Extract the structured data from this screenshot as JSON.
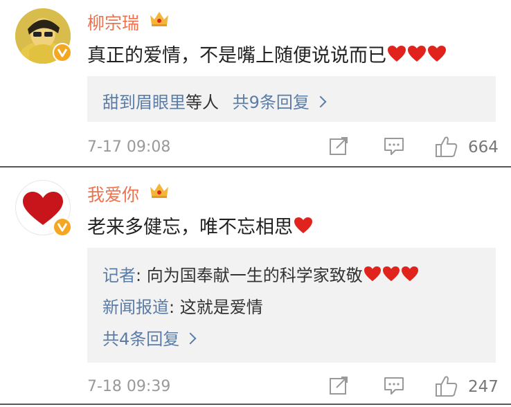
{
  "comments": [
    {
      "username": "柳宗瑞",
      "text": "真正的爱情，不是嘴上随便说说而已",
      "reply_summary": {
        "names": "甜到眉眼里",
        "suffix": "等人",
        "count_label": "共9条回复"
      },
      "time": "7-17 09:08",
      "likes": "664"
    },
    {
      "username": "我爱你",
      "text": "老来多健忘，唯不忘相思",
      "replies": [
        {
          "author": "记者",
          "text": ": 向为国奉献一生的科学家致敬"
        },
        {
          "author": "新闻报道",
          "text": ": 这就是爱情"
        }
      ],
      "more_label": "共4条回复",
      "time": "7-18 09:39",
      "likes": "247"
    }
  ],
  "colors": {
    "username": "#eb7350",
    "link": "#5a7ca6",
    "heart": "#e0241d",
    "verified_badge": "#f5a623",
    "reply_bg": "#f2f2f2"
  },
  "icons": [
    "crown-icon",
    "verified-icon",
    "heart-icon",
    "share-icon",
    "comment-icon",
    "like-icon",
    "chevron-right-icon"
  ]
}
